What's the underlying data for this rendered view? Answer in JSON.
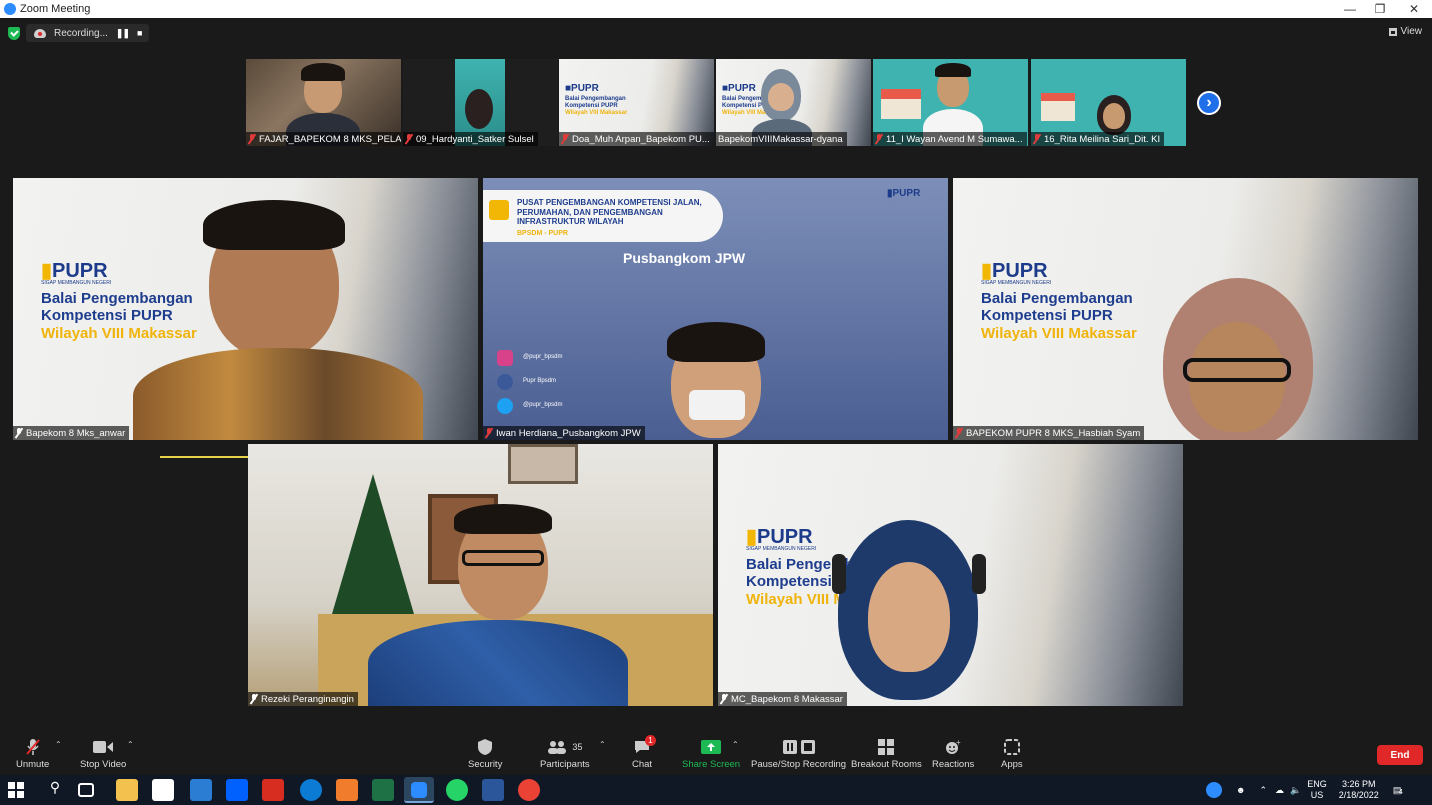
{
  "window": {
    "title": "Zoom Meeting"
  },
  "status": {
    "recording_label": "Recording...",
    "view_label": "View"
  },
  "thumbnails": [
    {
      "name": "FAJAR_BAPEKOM 8 MKS_PELA..."
    },
    {
      "name": "09_Hardyanti_Satker Sulsel"
    },
    {
      "name": "Doa_Muh Arpan_Bapekom PU..."
    },
    {
      "name": "BapekomVIIIMakassar-dyana"
    },
    {
      "name": "11_I Wayan Avend M Sumawa..."
    },
    {
      "name": "16_Rita Meilina Sari_Dit. KI"
    }
  ],
  "slide": {
    "logo": "PUPR",
    "tagline": "SIGAP MEMBANGUN NEGERI",
    "line1": "Balai Pengembangan",
    "line2": "Kompetensi PUPR",
    "line3": "Wilayah VIII Makassar"
  },
  "center_slide": {
    "title": "PUSAT PENGEMBANGAN KOMPETENSI JALAN, PERUMAHAN, DAN PENGEMBANGAN INFRASTRUKTUR WILAYAH",
    "subtitle": "BPSDM - PUPR",
    "building_sign": "Pusbangkom JPW",
    "social1": "@pupr_bpsdm",
    "social2": "Pupr Bpsdm",
    "social3": "@pupr_bpsdm"
  },
  "tiles": [
    {
      "name": "Bapekom 8 Mks_anwar"
    },
    {
      "name": "Iwan Herdiana_Pusbangkom JPW"
    },
    {
      "name": "BAPEKOM PUPR 8 MKS_Hasbiah Syam"
    },
    {
      "name": "Rezeki Peranginangin"
    },
    {
      "name": "MC_Bapekom 8 Makassar"
    }
  ],
  "toolbar": {
    "unmute": "Unmute",
    "stop_video": "Stop Video",
    "security": "Security",
    "participants": "Participants",
    "participants_count": "35",
    "chat": "Chat",
    "chat_badge": "1",
    "share_screen": "Share Screen",
    "pause_recording": "Pause/Stop Recording",
    "breakout": "Breakout Rooms",
    "reactions": "Reactions",
    "apps": "Apps",
    "end": "End"
  },
  "taskbar": {
    "lang1": "ENG",
    "lang2": "US",
    "time": "3:26 PM",
    "date": "2/18/2022",
    "notif_count": "4"
  },
  "colors": {
    "zoom_blue": "#2d8cff",
    "share_green": "#1db954",
    "end_red": "#e02828"
  }
}
